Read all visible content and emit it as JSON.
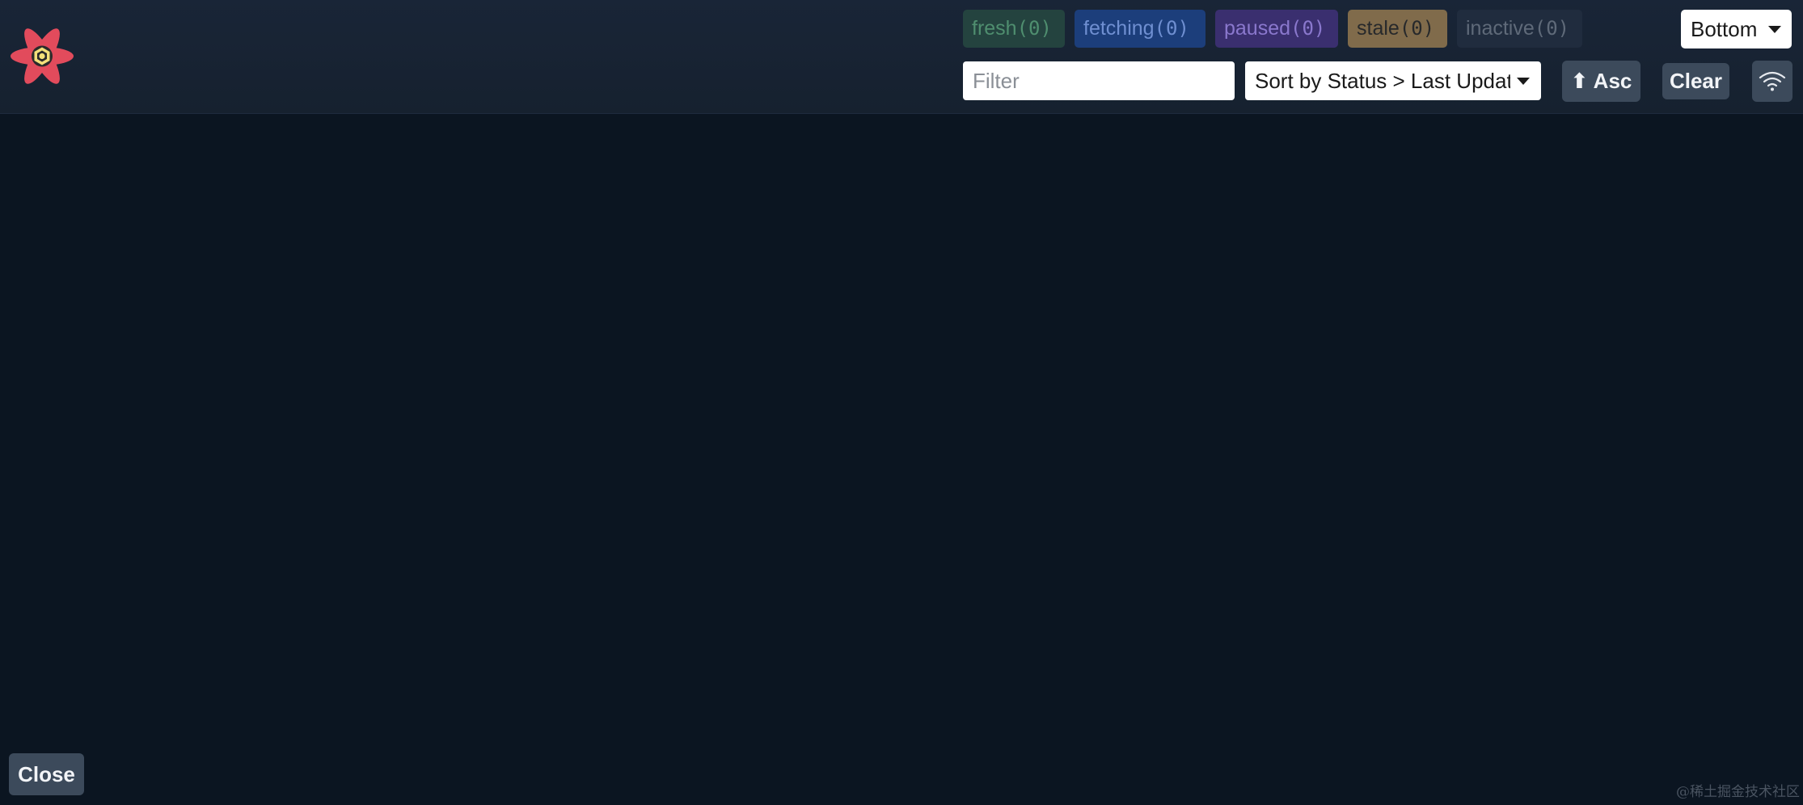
{
  "header": {
    "logo_icon": "react-query-logo-icon",
    "status_chips": [
      {
        "label": "fresh",
        "count": "(0)"
      },
      {
        "label": "fetching",
        "count": "(0)"
      },
      {
        "label": "paused",
        "count": "(0)"
      },
      {
        "label": "stale",
        "count": "(0)"
      },
      {
        "label": "inactive",
        "count": "(0)"
      }
    ],
    "position_select": {
      "value": "Bottom"
    },
    "filter": {
      "placeholder": "Filter",
      "value": ""
    },
    "sort_select": {
      "value": "Sort by Status > Last Updated"
    },
    "asc_button": {
      "arrow": "⬆",
      "label": "Asc"
    },
    "clear_button": {
      "label": "Clear"
    },
    "online_button": {
      "icon": "wifi-icon"
    }
  },
  "footer": {
    "close_button": {
      "label": "Close"
    },
    "watermark": "@稀土掘金技术社区"
  },
  "colors": {
    "background": "#0b1521",
    "header": "#16212f",
    "button": "#3c4a5b",
    "logo_red": "#e24b5c",
    "logo_yellow": "#f4e07a"
  }
}
